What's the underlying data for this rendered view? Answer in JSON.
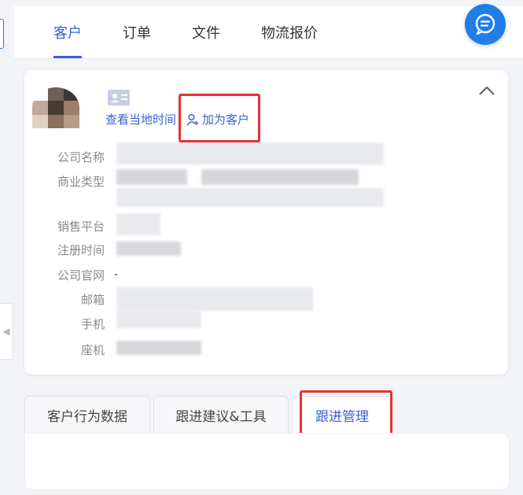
{
  "header": {
    "tabs": [
      {
        "label": "客户",
        "active": true
      },
      {
        "label": "订单",
        "active": false
      },
      {
        "label": "文件",
        "active": false
      },
      {
        "label": "物流报价",
        "active": false
      }
    ],
    "chat_icon": "chat-bubble-icon"
  },
  "profile": {
    "local_time_link": "查看当地时间",
    "add_customer_button": "加为客户",
    "fields": [
      {
        "label": "公司名称",
        "value": ""
      },
      {
        "label": "商业类型",
        "value": ""
      },
      {
        "label": "销售平台",
        "value": ""
      },
      {
        "label": "注册时间",
        "value": ""
      },
      {
        "label": "公司官网",
        "value": "-"
      },
      {
        "label": "邮箱",
        "value": ""
      },
      {
        "label": "手机",
        "value": ""
      },
      {
        "label": "座机",
        "value": ""
      }
    ]
  },
  "sub_tabs": [
    {
      "label": "客户行为数据",
      "active": false
    },
    {
      "label": "跟进建议&工具",
      "active": false
    },
    {
      "label": "跟进管理",
      "active": true
    }
  ],
  "colors": {
    "accent": "#3a61d8",
    "chat_button": "#1f7fe7",
    "highlight": "#e53232"
  }
}
